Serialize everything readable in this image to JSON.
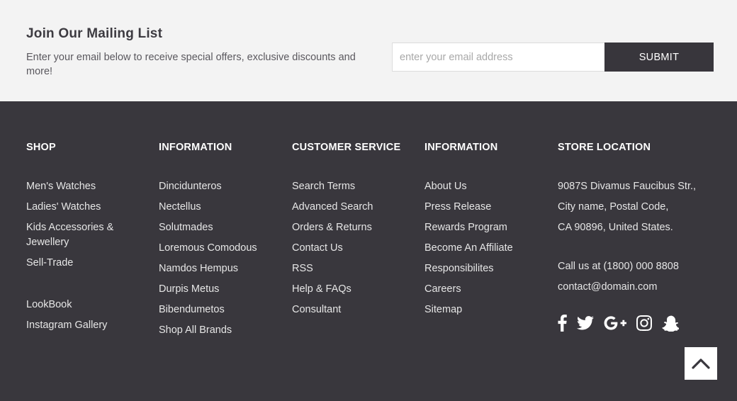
{
  "newsletter": {
    "title": "Join Our Mailing List",
    "description": "Enter your email below to receive special offers, exclusive discounts and more!",
    "email_placeholder": "enter your email address",
    "submit_label": "SUBMIT"
  },
  "footer": {
    "shop": {
      "heading": "SHOP",
      "links": [
        "Men's Watches",
        "Ladies' Watches",
        "Kids Accessories & Jewellery",
        "Sell-Trade",
        "LookBook",
        "Instagram Gallery"
      ]
    },
    "information1": {
      "heading": "INFORMATION",
      "links": [
        "Dincidunteros",
        "Nectellus",
        "Solutmades",
        "Loremous Comodous",
        "Namdos Hempus",
        "Durpis Metus",
        "Bibendumetos",
        "Shop All Brands"
      ]
    },
    "customer_service": {
      "heading": "CUSTOMER SERVICE",
      "links": [
        "Search Terms",
        "Advanced Search",
        "Orders & Returns",
        "Contact Us",
        "RSS",
        "Help & FAQs",
        "Consultant"
      ]
    },
    "information2": {
      "heading": "INFORMATION",
      "links": [
        "About Us",
        "Press Release",
        "Rewards Program",
        "Become An Affiliate",
        "Responsibilites",
        "Careers",
        "Sitemap"
      ]
    },
    "store": {
      "heading": "STORE LOCATION",
      "address": [
        "9087S Divamus Faucibus Str.,",
        "City name, Postal Code,",
        "CA 90896, United States."
      ],
      "phone": "Call us at (1800) 000 8808",
      "email": "contact@domain.com"
    },
    "social_icons": [
      "facebook-icon",
      "twitter-icon",
      "google-plus-icon",
      "instagram-icon",
      "snapchat-icon"
    ],
    "back_to_top_icon": "chevron-up-icon"
  },
  "colors": {
    "footer_bg": "#39373d",
    "newsletter_bg": "#f3f3f3",
    "submit_bg": "#38363c",
    "text_light": "#e6e6e6"
  }
}
